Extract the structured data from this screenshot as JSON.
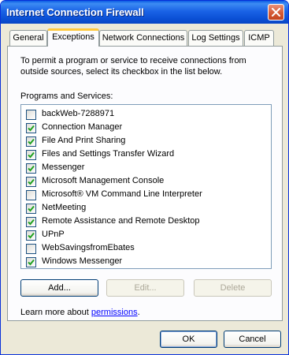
{
  "window": {
    "title": "Internet Connection Firewall"
  },
  "tabs": [
    {
      "label": "General"
    },
    {
      "label": "Exceptions"
    },
    {
      "label": "Network Connections"
    },
    {
      "label": "Log Settings"
    },
    {
      "label": "ICMP"
    }
  ],
  "exceptions": {
    "description": "To permit a program or service to receive connections from outside sources, select its checkbox in the list below.",
    "list_label": "Programs and Services:",
    "items": [
      {
        "label": "backWeb-7288971",
        "checked": false
      },
      {
        "label": "Connection Manager",
        "checked": true
      },
      {
        "label": "File And Print Sharing",
        "checked": true
      },
      {
        "label": "Files and Settings Transfer Wizard",
        "checked": true
      },
      {
        "label": "Messenger",
        "checked": true
      },
      {
        "label": "Microsoft Management Console",
        "checked": true
      },
      {
        "label": "Microsoft® VM Command Line Interpreter",
        "checked": false
      },
      {
        "label": "NetMeeting",
        "checked": true
      },
      {
        "label": "Remote Assistance and Remote Desktop",
        "checked": true
      },
      {
        "label": "UPnP",
        "checked": true
      },
      {
        "label": "WebSavingsfromEbates",
        "checked": false
      },
      {
        "label": "Windows Messenger",
        "checked": true
      }
    ],
    "add_label": "Add...",
    "edit_label": "Edit...",
    "delete_label": "Delete",
    "learn_prefix": "Learn more about ",
    "learn_link": "permissions",
    "learn_suffix": "."
  },
  "footer": {
    "ok_label": "OK",
    "cancel_label": "Cancel"
  },
  "icons": {
    "close": "close-icon",
    "checkmark": "checkmark-icon"
  },
  "colors": {
    "titlebar": "#0a4fd4",
    "active_tab_accent": "#ffc83c",
    "check": "#21a121",
    "link": "#0000ff",
    "close_button": "#d45a36"
  }
}
